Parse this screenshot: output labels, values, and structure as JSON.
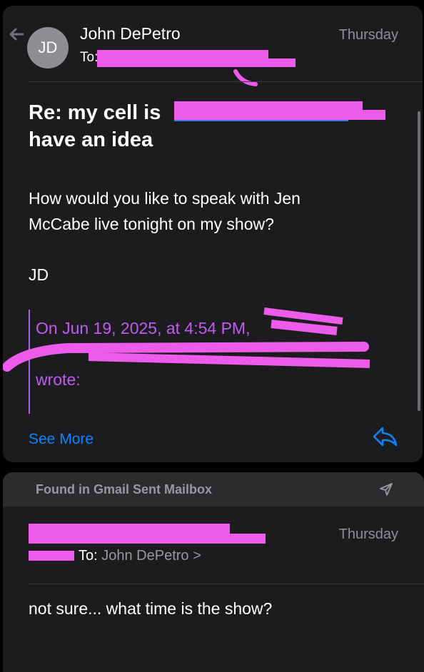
{
  "message1": {
    "avatar_initials": "JD",
    "sender": "John DePetro",
    "to_label": "To:",
    "date": "Thursday",
    "subject_line1": "Re: my cell is",
    "subject_line2": "have an idea",
    "body_line1": "How would you like to speak with Jen",
    "body_line2": "McCabe live tonight on my show?",
    "signature": "JD",
    "quote_line1": "On Jun 19, 2025, at 4:54 PM,",
    "quote_line3": "wrote:",
    "see_more": "See More"
  },
  "message2": {
    "found_in": "Found in Gmail Sent Mailbox",
    "date": "Thursday",
    "to_label": "To:",
    "recipient": "John DePetro >",
    "body": "not sure... what time is the show?"
  },
  "icons": {
    "reply_indicator": "reply-arrow-icon",
    "reply_button": "reply-icon",
    "send": "paper-plane-icon"
  },
  "colors": {
    "background": "#000000",
    "card": "#1c1c1e",
    "accent": "#0a84ff",
    "quote": "#bf5af2",
    "redaction": "#ec5bea"
  }
}
